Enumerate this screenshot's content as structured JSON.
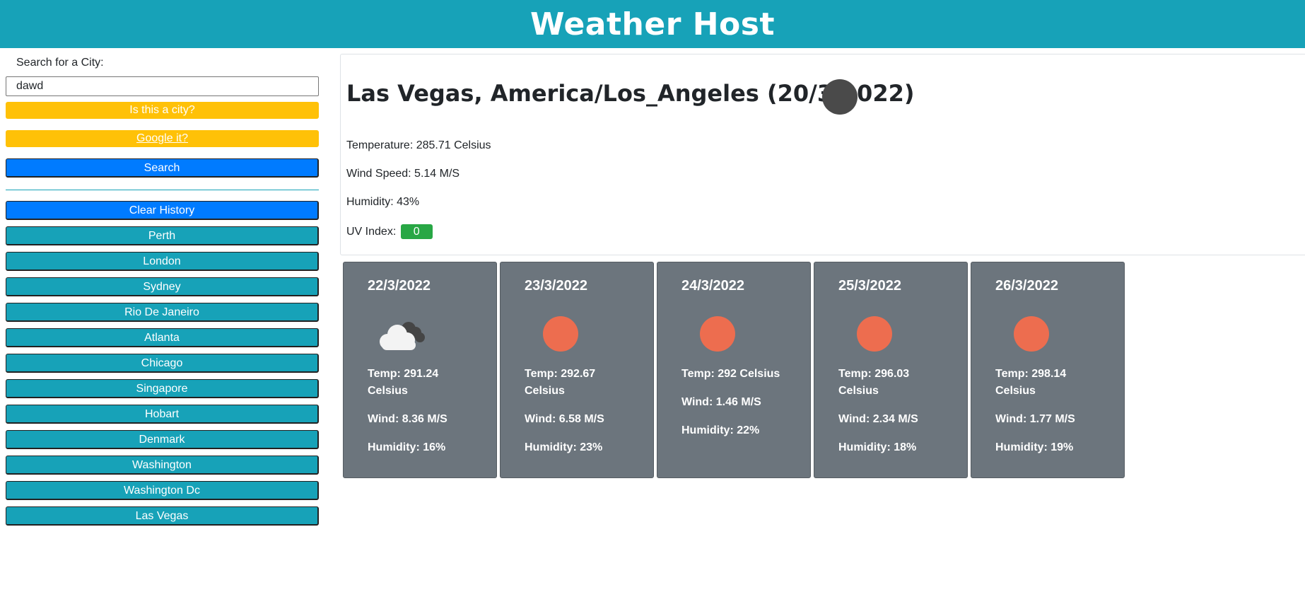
{
  "header": {
    "title": "Weather Host"
  },
  "sidebar": {
    "search_label": "Search for a City:",
    "search_value": "dawd",
    "warn_question": "Is this a city?",
    "warn_google": "Google it?",
    "search_button": "Search",
    "clear_button": "Clear History",
    "history": [
      "Perth",
      "London",
      "Sydney",
      "Rio De Janeiro",
      "Atlanta",
      "Chicago",
      "Singapore",
      "Hobart",
      "Denmark",
      "Washington",
      "Washington Dc",
      "Las Vegas"
    ]
  },
  "current": {
    "title": "Las Vegas, America/Los_Angeles (20/3/2022)",
    "icon": "dark-circle-icon",
    "temperature": "Temperature: 285.71 Celsius",
    "wind": "Wind Speed: 5.14 M/S",
    "humidity": "Humidity: 43%",
    "uv_label": "UV Index:",
    "uv_value": "0"
  },
  "forecast": [
    {
      "date": "22/3/2022",
      "icon": "cloudy-icon",
      "temp": "Temp: 291.24 Celsius",
      "wind": "Wind: 8.36 M/S",
      "humidity": "Humidity: 16%"
    },
    {
      "date": "23/3/2022",
      "icon": "sun-icon",
      "temp": "Temp: 292.67 Celsius",
      "wind": "Wind: 6.58 M/S",
      "humidity": "Humidity: 23%"
    },
    {
      "date": "24/3/2022",
      "icon": "sun-icon",
      "temp": "Temp: 292 Celsius",
      "wind": "Wind: 1.46 M/S",
      "humidity": "Humidity: 22%"
    },
    {
      "date": "25/3/2022",
      "icon": "sun-icon",
      "temp": "Temp: 296.03 Celsius",
      "wind": "Wind: 2.34 M/S",
      "humidity": "Humidity: 18%"
    },
    {
      "date": "26/3/2022",
      "icon": "sun-icon",
      "temp": "Temp: 298.14 Celsius",
      "wind": "Wind: 1.77 M/S",
      "humidity": "Humidity: 19%"
    }
  ],
  "colors": {
    "header": "#17a2b8",
    "warning": "#ffc107",
    "primary": "#007bff",
    "uv_good": "#28a745",
    "card": "#6c757d",
    "sun": "#ed6d4f"
  }
}
